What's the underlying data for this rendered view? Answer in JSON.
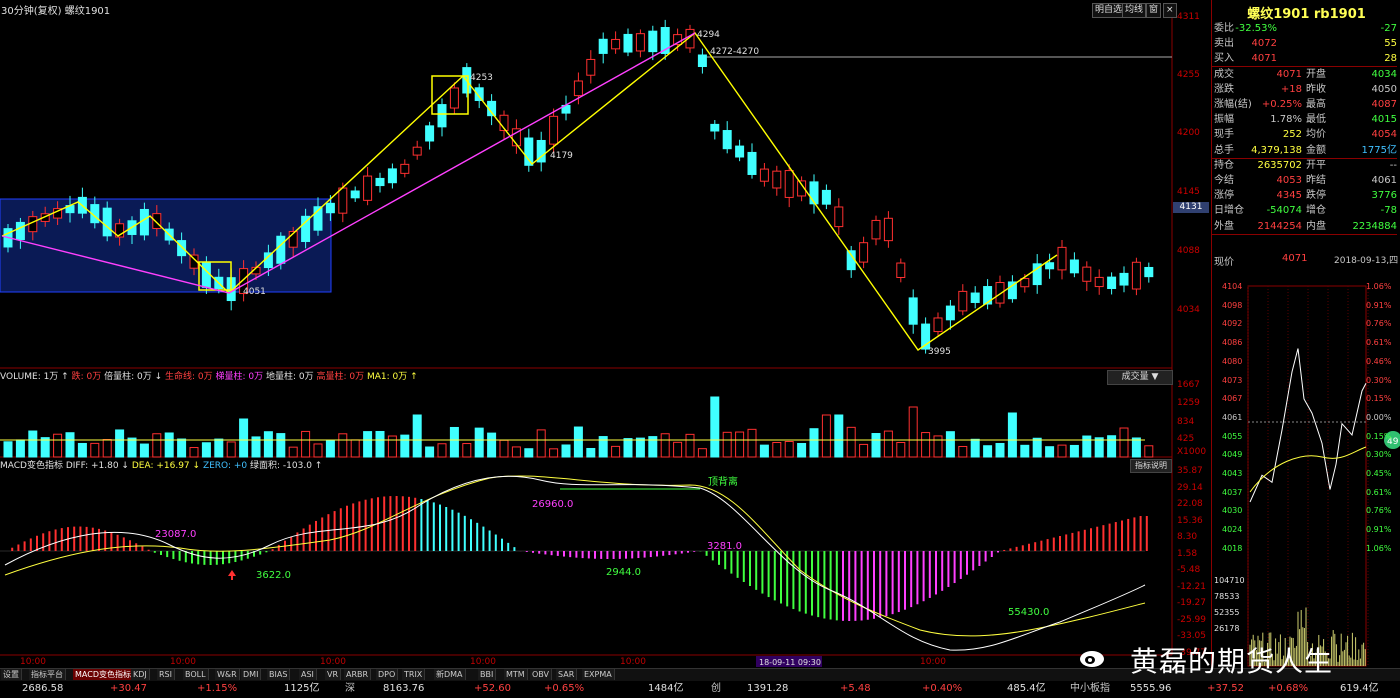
{
  "window": {
    "title": "30分钟(复权)  螺纹1901",
    "buttons": [
      "明自选",
      "均线",
      "窗"
    ],
    "close": "×"
  },
  "main_chart": {
    "type": "candlestick",
    "y_ticks": [
      "4311",
      "4255",
      "4200",
      "4145",
      "4131",
      "4088",
      "4034"
    ],
    "annotations": [
      "4294",
      "4272-4270",
      "4253",
      "4179",
      "4051",
      "3995"
    ],
    "price_tag": "4131"
  },
  "volume_panel": {
    "header": [
      {
        "text": "VOLUME: 1万 ↑",
        "color": "#e0e0e0"
      },
      {
        "text": "跌: 0万",
        "color": "#ff4040"
      },
      {
        "text": "倍量柱: 0万 ↓",
        "color": "#e0e0e0"
      },
      {
        "text": "生命线: 0万",
        "color": "#ff4040"
      },
      {
        "text": "梯量柱: 0万",
        "color": "#ff40ff"
      },
      {
        "text": "地量柱: 0万",
        "color": "#e0e0e0"
      },
      {
        "text": "高量柱: 0万",
        "color": "#ff4040"
      },
      {
        "text": "MA1: 0万 ↑",
        "color": "#ffff40"
      }
    ],
    "button": "成交量",
    "y_ticks": [
      "1667",
      "1259",
      "834",
      "425",
      "X1000"
    ]
  },
  "macd_panel": {
    "header": [
      {
        "text": "MACD变色指标 DIFF: +1.80 ↓",
        "color": "#e0e0e0"
      },
      {
        "text": "DEA: +16.97 ↓",
        "color": "#ffff40"
      },
      {
        "text": "ZERO: +0",
        "color": "#40c0ff"
      },
      {
        "text": "绿面积: -103.0 ↑",
        "color": "#e0e0e0"
      }
    ],
    "button": "指标说明",
    "y_ticks": [
      "35.87",
      "29.14",
      "22.08",
      "15.36",
      "8.30",
      "1.58",
      "-5.48",
      "-12.21",
      "-19.27",
      "-25.99",
      "-33.05",
      "-39.77"
    ],
    "labels": [
      {
        "text": "23087.0",
        "color": "#ff40ff"
      },
      {
        "text": "26960.0",
        "color": "#ff40ff"
      },
      {
        "text": "3281.0",
        "color": "#ff40ff"
      },
      {
        "text": "3622.0",
        "color": "#40ff40"
      },
      {
        "text": "2944.0",
        "color": "#40ff40"
      },
      {
        "text": "55430.0",
        "color": "#40ff40"
      },
      {
        "text": "顶背离",
        "color": "#40ff40"
      }
    ]
  },
  "time_axis": [
    "10:00",
    "10:00",
    "10:00",
    "10:00",
    "10:00",
    "10:00"
  ],
  "cursor_time": "18-09-11 09:30",
  "quote_panel": {
    "title": "螺纹1901 rb1901",
    "rows": [
      {
        "label": "委比",
        "v1": "-32.53%",
        "c1": "#40ff40",
        "v2": "-27",
        "c2": "#40ff40"
      },
      {
        "label": "卖出",
        "v1": "4072",
        "c1": "#ff4040",
        "v2": "55",
        "c2": "#ffff40"
      },
      {
        "label": "买入",
        "v1": "4071",
        "c1": "#ff4040",
        "v2": "28",
        "c2": "#ffff40"
      },
      {
        "label": "成交",
        "v1": "4071",
        "c1": "#ff4040",
        "l2": "开盘",
        "v2": "4034",
        "c2": "#40ff40"
      },
      {
        "label": "涨跌",
        "v1": "+18",
        "c1": "#ff4040",
        "l2": "昨收",
        "v2": "4050",
        "c2": "#c8c8c8"
      },
      {
        "label": "涨幅(结)",
        "v1": "+0.25%",
        "c1": "#ff4040",
        "l2": "最高",
        "v2": "4087",
        "c2": "#ff4040"
      },
      {
        "label": "振幅",
        "v1": "1.78%",
        "c1": "#c8c8c8",
        "l2": "最低",
        "v2": "4015",
        "c2": "#40ff40"
      },
      {
        "label": "现手",
        "v1": "252",
        "c1": "#ffff40",
        "l2": "均价",
        "v2": "4054",
        "c2": "#ff4040"
      },
      {
        "label": "总手",
        "v1": "4,379,138",
        "c1": "#ffff40",
        "l2": "金额",
        "v2": "1775亿",
        "c2": "#40c0ff"
      },
      {
        "label": "持仓",
        "v1": "2635702",
        "c1": "#ffff40",
        "l2": "开平",
        "v2": "--",
        "c2": "#c8c8c8"
      },
      {
        "label": "今结",
        "v1": "4053",
        "c1": "#ff4040",
        "l2": "昨结",
        "v2": "4061",
        "c2": "#c8c8c8"
      },
      {
        "label": "涨停",
        "v1": "4345",
        "c1": "#ff4040",
        "l2": "跌停",
        "v2": "3776",
        "c2": "#40ff40"
      },
      {
        "label": "日增仓",
        "v1": "-54074",
        "c1": "#40ff40",
        "l2": "增仓",
        "v2": "-78",
        "c2": "#40ff40"
      },
      {
        "label": "外盘",
        "v1": "2144254",
        "c1": "#ff4040",
        "l2": "内盘",
        "v2": "2234884",
        "c2": "#40ff40"
      }
    ],
    "now_label": "现价",
    "now_price": "4071",
    "now_date": "2018-09-13,四"
  },
  "intraday": {
    "left_ticks": [
      "4104",
      "4098",
      "4092",
      "4086",
      "4080",
      "4073",
      "4067",
      "4061",
      "4055",
      "4049",
      "4043",
      "4037",
      "4030",
      "4024",
      "4018"
    ],
    "right_ticks": [
      "1.06%",
      "0.91%",
      "0.76%",
      "0.61%",
      "0.46%",
      "0.30%",
      "0.15%",
      "0.00%",
      "0.15%",
      "0.30%",
      "0.45%",
      "0.61%",
      "0.76%",
      "0.91%",
      "1.06%"
    ],
    "vol_ticks": [
      "104710",
      "78533",
      "52355",
      "26178"
    ]
  },
  "indicator_tabs": [
    "设置",
    "指标平台",
    "MACD变色指标",
    "KDJ",
    "RSI",
    "BOLL",
    "W&R",
    "DMI",
    "BIAS",
    "ASI",
    "VR",
    "ARBR",
    "DPO",
    "TRIX",
    "新DMA",
    "BBI",
    "MTM",
    "OBV",
    "SAR",
    "EXPMA"
  ],
  "status_bar": [
    {
      "text": "2686.58",
      "color": "#e0e0e0"
    },
    {
      "text": "+30.47",
      "color": "#ff4040"
    },
    {
      "text": "+1.15%",
      "color": "#ff4040"
    },
    {
      "text": "1125亿",
      "color": "#e0e0e0"
    },
    {
      "text": "深",
      "color": "#c8c8c8"
    },
    {
      "text": "8163.76",
      "color": "#e0e0e0"
    },
    {
      "text": "+52.60",
      "color": "#ff4040"
    },
    {
      "text": "+0.65%",
      "color": "#ff4040"
    },
    {
      "text": "1484亿",
      "color": "#e0e0e0"
    },
    {
      "text": "创",
      "color": "#c8c8c8"
    },
    {
      "text": "1391.28",
      "color": "#e0e0e0"
    },
    {
      "text": "+5.48",
      "color": "#ff4040"
    },
    {
      "text": "+0.40%",
      "color": "#ff4040"
    },
    {
      "text": "485.4亿",
      "color": "#e0e0e0"
    },
    {
      "text": "中小板指",
      "color": "#c8c8c8"
    },
    {
      "text": "5555.96",
      "color": "#e0e0e0"
    },
    {
      "text": "+37.52",
      "color": "#ff4040"
    },
    {
      "text": "+0.68%",
      "color": "#ff4040"
    },
    {
      "text": "619.4亿",
      "color": "#e0e0e0"
    }
  ],
  "watermark": "黄磊的期货人生",
  "badge": "49"
}
